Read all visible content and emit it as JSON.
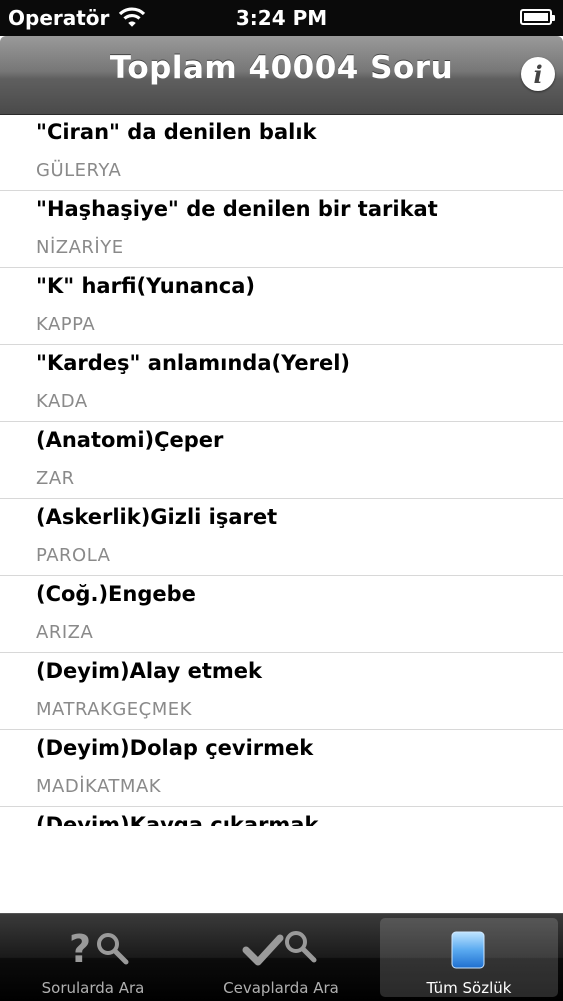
{
  "status_bar": {
    "carrier": "Operatör",
    "time": "3:24 PM"
  },
  "nav": {
    "title": "Toplam 40004 Soru"
  },
  "items": [
    {
      "question": "\"Ciran\" da denilen balık",
      "answer": "GÜLERYA"
    },
    {
      "question": "\"Haşhaşiye\" de denilen bir tarikat",
      "answer": "NİZARİYE"
    },
    {
      "question": "\"K\" harfi(Yunanca)",
      "answer": "KAPPA"
    },
    {
      "question": "\"Kardeş\" anlamında(Yerel)",
      "answer": "KADA"
    },
    {
      "question": "(Anatomi)Çeper",
      "answer": "ZAR"
    },
    {
      "question": "(Askerlik)Gizli işaret",
      "answer": "PAROLA"
    },
    {
      "question": "(Coğ.)Engebe",
      "answer": "ARIZA"
    },
    {
      "question": "(Deyim)Alay etmek",
      "answer": "MATRAKGEÇMEK"
    },
    {
      "question": "(Deyim)Dolap çevirmek",
      "answer": "MADİKATMAK"
    },
    {
      "question": "(Deyim)Kavga çıkarmak",
      "answer": ""
    }
  ],
  "tabs": [
    {
      "label": "Sorularda Ara",
      "icon": "question-search-icon"
    },
    {
      "label": "Cevaplarda Ara",
      "icon": "check-search-icon"
    },
    {
      "label": "Tüm Sözlük",
      "icon": "dictionary-icon"
    }
  ]
}
